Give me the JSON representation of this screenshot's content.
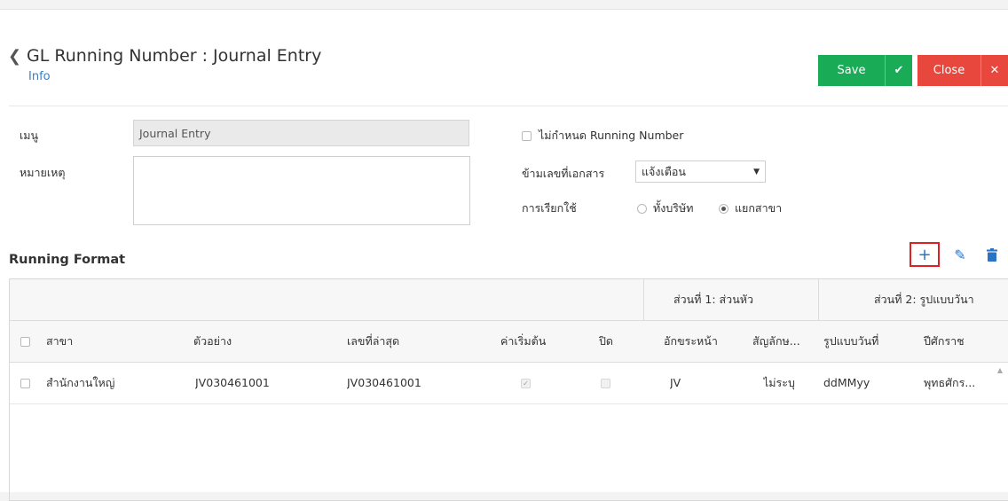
{
  "header": {
    "title": "GL Running Number : Journal Entry",
    "info_link": "Info",
    "save_label": "Save",
    "close_label": "Close"
  },
  "form": {
    "menu_label": "เมนู",
    "menu_value": "Journal Entry",
    "remark_label": "หมายเหตุ",
    "no_running_label": "ไม่กำหนด Running Number",
    "skip_doc_label": "ข้ามเลขที่เอกสาร",
    "skip_doc_value": "แจ้งเตือน",
    "usage_label": "การเรียกใช้",
    "usage_options": [
      "ทั้งบริษัท",
      "แยกสาขา"
    ],
    "usage_selected": "แยกสาขา"
  },
  "section": {
    "title": "Running Format"
  },
  "table": {
    "groups": [
      "ส่วนที่ 1: ส่วนหัว",
      "ส่วนที่ 2: รูปแบบวันา"
    ],
    "columns": [
      "สาขา",
      "ตัวอย่าง",
      "เลขที่ล่าสุด",
      "ค่าเริ่มต้น",
      "ปิด",
      "อักขระหน้า",
      "สัญลักษ...",
      "รูปแบบวันที่",
      "ปีศักราช"
    ],
    "rows": [
      {
        "branch": "สำนักงานใหญ่",
        "example": "JV030461001",
        "last_number": "JV030461001",
        "default": true,
        "closed": false,
        "prefix": "JV",
        "symbol": "ไม่ระบุ",
        "date_format": "ddMMyy",
        "era": "พุทธศักร..."
      }
    ]
  },
  "colors": {
    "save": "#1aab57",
    "close": "#e8473d",
    "link": "#3b7dc4",
    "highlight": "#e02020"
  }
}
